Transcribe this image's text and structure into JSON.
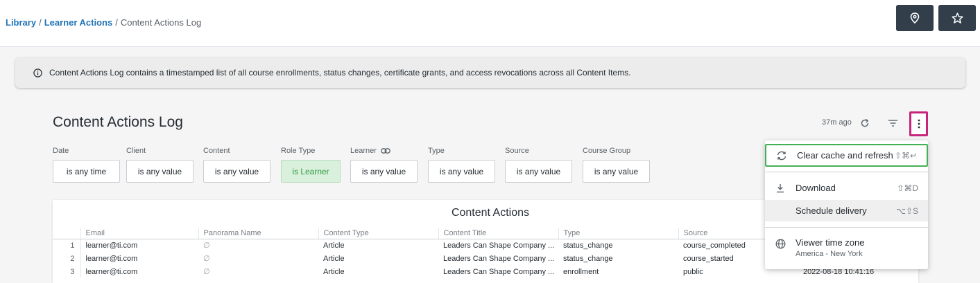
{
  "breadcrumb": {
    "items": [
      "Library",
      "Learner Actions"
    ],
    "current": "Content Actions Log",
    "separator": "/"
  },
  "toolbar": {
    "location_icon": "map-pin-icon",
    "favorite_icon": "star-icon"
  },
  "banner": {
    "icon": "info-icon",
    "text": "Content Actions Log contains a timestamped list of all course enrollments, status changes, certificate grants, and access revocations across all Content Items."
  },
  "dashboard": {
    "title": "Content Actions Log",
    "last_updated": "37m ago"
  },
  "filters": [
    {
      "label": "Date",
      "value": "is any time",
      "active": false
    },
    {
      "label": "Client",
      "value": "is any value",
      "active": false
    },
    {
      "label": "Content",
      "value": "is any value",
      "active": false
    },
    {
      "label": "Role Type",
      "value": "is Learner",
      "active": true
    },
    {
      "label": "Learner",
      "value": "is any value",
      "active": false,
      "linked": true
    },
    {
      "label": "Type",
      "value": "is any value",
      "active": false
    },
    {
      "label": "Source",
      "value": "is any value",
      "active": false
    },
    {
      "label": "Course Group",
      "value": "is any value",
      "active": false
    }
  ],
  "table": {
    "title": "Content Actions",
    "columns": [
      "Email",
      "Panorama Name",
      "Content Type",
      "Content Title",
      "Type",
      "Source",
      ""
    ],
    "rows": [
      {
        "n": "1",
        "email": "learner@ti.com",
        "panorama": "∅",
        "content_type": "Article",
        "content_title": "Leaders Can Shape Company ...",
        "type": "status_change",
        "source": "course_completed",
        "time": ""
      },
      {
        "n": "2",
        "email": "learner@ti.com",
        "panorama": "∅",
        "content_type": "Article",
        "content_title": "Leaders Can Shape Company ...",
        "type": "status_change",
        "source": "course_started",
        "time": ""
      },
      {
        "n": "3",
        "email": "learner@ti.com",
        "panorama": "∅",
        "content_type": "Article",
        "content_title": "Leaders Can Shape Company ...",
        "type": "enrollment",
        "source": "public",
        "time": "2022-08-18 10:41:16"
      }
    ]
  },
  "menu": {
    "items": [
      {
        "label": "Clear cache and refresh",
        "shortcut": "⇧⌘↵",
        "icon": "refresh-cycle-icon"
      },
      {
        "label": "Download",
        "shortcut": "⇧⌘D",
        "icon": "download-icon"
      },
      {
        "label": "Schedule delivery",
        "shortcut": "⌥⇧S",
        "icon": ""
      },
      {
        "label": "Viewer time zone",
        "sublabel": "America - New York",
        "icon": "globe-icon"
      }
    ]
  },
  "colors": {
    "link": "#1f73b7",
    "dark_button": "#323f4b",
    "highlight_pink": "#c7257b",
    "highlight_green": "#44b055",
    "active_filter_bg": "#d9f0dc"
  }
}
